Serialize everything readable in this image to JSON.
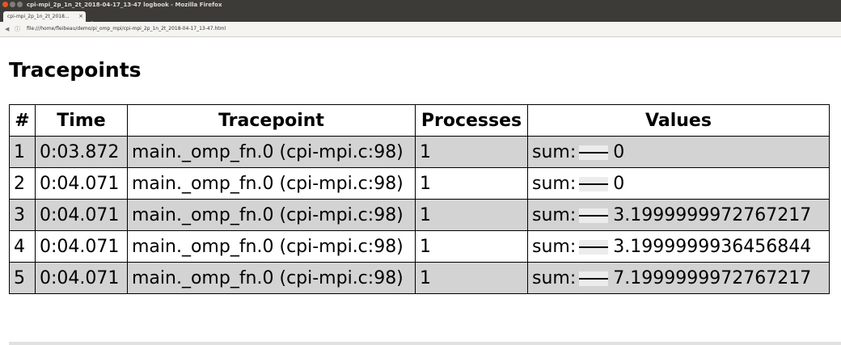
{
  "window": {
    "title": "cpi-mpi_2p_1n_2t_2018-04-17_13-47 logbook - Mozilla Firefox",
    "tab_label": "cpi-mpi_2p_1n_2t_2018...",
    "tab_close": "×",
    "new_tab": "+",
    "url": "file:///home/fleibeau/demo/pi_omp_mpi/cpi-mpi_2p_1n_2t_2018-04-17_13-47.html"
  },
  "page": {
    "heading": "Tracepoints"
  },
  "table": {
    "headers": [
      "#",
      "Time",
      "Tracepoint",
      "Processes",
      "Values"
    ],
    "rows": [
      {
        "num": "1",
        "time": "0:03.872",
        "tracepoint": "main._omp_fn.0 (cpi-mpi.c:98)",
        "processes": "1",
        "value_label": "sum:",
        "value": "0"
      },
      {
        "num": "2",
        "time": "0:04.071",
        "tracepoint": "main._omp_fn.0 (cpi-mpi.c:98)",
        "processes": "1",
        "value_label": "sum:",
        "value": "0"
      },
      {
        "num": "3",
        "time": "0:04.071",
        "tracepoint": "main._omp_fn.0 (cpi-mpi.c:98)",
        "processes": "1",
        "value_label": "sum:",
        "value": "3.1999999972767217"
      },
      {
        "num": "4",
        "time": "0:04.071",
        "tracepoint": "main._omp_fn.0 (cpi-mpi.c:98)",
        "processes": "1",
        "value_label": "sum:",
        "value": "3.1999999936456844"
      },
      {
        "num": "5",
        "time": "0:04.071",
        "tracepoint": "main._omp_fn.0 (cpi-mpi.c:98)",
        "processes": "1",
        "value_label": "sum:",
        "value": "7.1999999972767217"
      }
    ]
  },
  "colors": {
    "row_shade": "#d3d3d3",
    "titlebar": "#3c3b37"
  }
}
